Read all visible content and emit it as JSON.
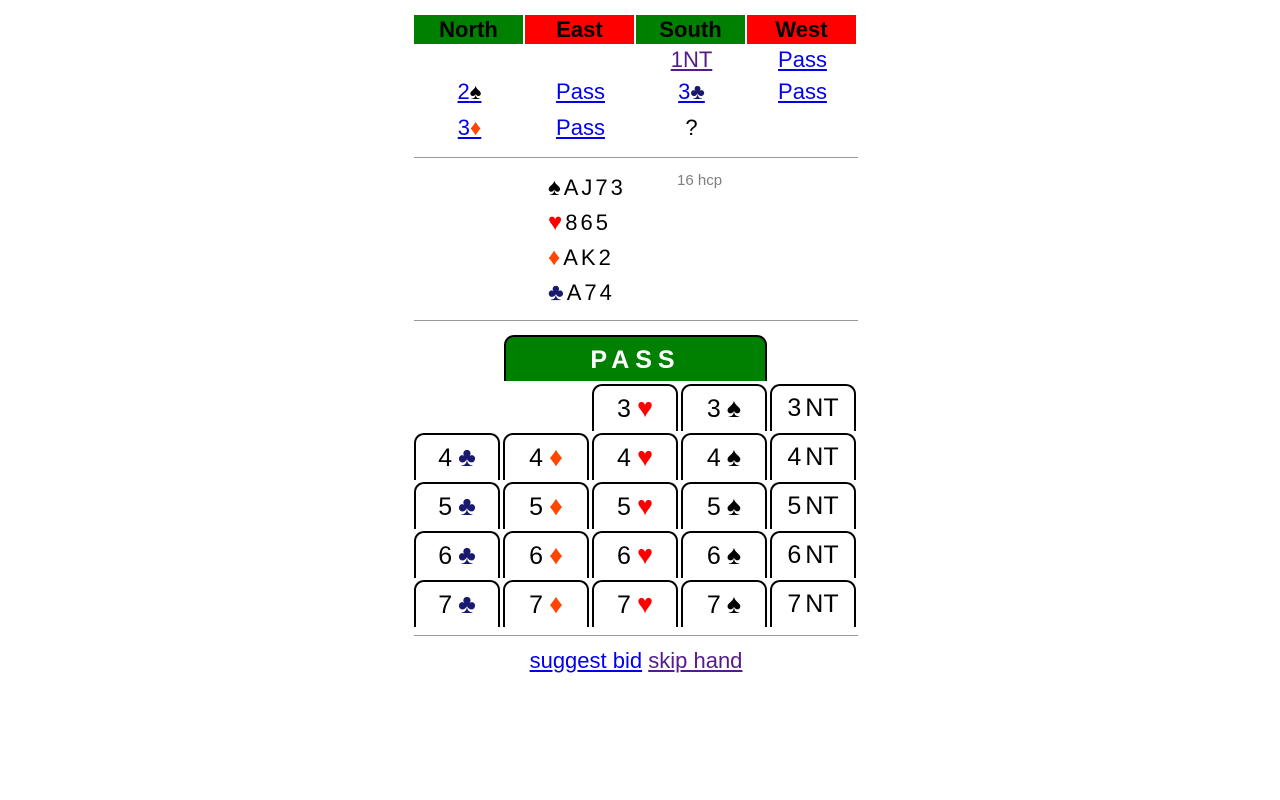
{
  "auction": {
    "headers": [
      {
        "label": "North",
        "color": "#008000"
      },
      {
        "label": "East",
        "color": "#ff0000"
      },
      {
        "label": "South",
        "color": "#008000"
      },
      {
        "label": "West",
        "color": "#ff0000"
      }
    ],
    "row1": {
      "south": "1NT",
      "west": "Pass"
    },
    "row2": {
      "north_level": "2",
      "north_suit": "♠",
      "east": "Pass",
      "south_level": "3",
      "south_suit": "♣",
      "west": "Pass"
    },
    "row3": {
      "north_level": "3",
      "north_suit": "♦",
      "east": "Pass",
      "south": "?"
    }
  },
  "hand": {
    "spades": {
      "symbol": "♠",
      "cards": "AJ73"
    },
    "hearts": {
      "symbol": "♥",
      "cards": "865"
    },
    "diamonds": {
      "symbol": "♦",
      "cards": "AK2"
    },
    "clubs": {
      "symbol": "♣",
      "cards": "A74"
    },
    "hcp": "16 hcp"
  },
  "bidbox": {
    "pass_label": "PASS",
    "bids": [
      {
        "level": "3",
        "suit": "♥",
        "kind": "heart"
      },
      {
        "level": "3",
        "suit": "♠",
        "kind": "spade"
      },
      {
        "level": "3",
        "suit": "NT",
        "kind": "nt"
      },
      {
        "level": "4",
        "suit": "♣",
        "kind": "club"
      },
      {
        "level": "4",
        "suit": "♦",
        "kind": "diamond"
      },
      {
        "level": "4",
        "suit": "♥",
        "kind": "heart"
      },
      {
        "level": "4",
        "suit": "♠",
        "kind": "spade"
      },
      {
        "level": "4",
        "suit": "NT",
        "kind": "nt"
      },
      {
        "level": "5",
        "suit": "♣",
        "kind": "club"
      },
      {
        "level": "5",
        "suit": "♦",
        "kind": "diamond"
      },
      {
        "level": "5",
        "suit": "♥",
        "kind": "heart"
      },
      {
        "level": "5",
        "suit": "♠",
        "kind": "spade"
      },
      {
        "level": "5",
        "suit": "NT",
        "kind": "nt"
      },
      {
        "level": "6",
        "suit": "♣",
        "kind": "club"
      },
      {
        "level": "6",
        "suit": "♦",
        "kind": "diamond"
      },
      {
        "level": "6",
        "suit": "♥",
        "kind": "heart"
      },
      {
        "level": "6",
        "suit": "♠",
        "kind": "spade"
      },
      {
        "level": "6",
        "suit": "NT",
        "kind": "nt"
      },
      {
        "level": "7",
        "suit": "♣",
        "kind": "club"
      },
      {
        "level": "7",
        "suit": "♦",
        "kind": "diamond"
      },
      {
        "level": "7",
        "suit": "♥",
        "kind": "heart"
      },
      {
        "level": "7",
        "suit": "♠",
        "kind": "spade"
      },
      {
        "level": "7",
        "suit": "NT",
        "kind": "nt"
      }
    ]
  },
  "footer": {
    "suggest_label": "suggest bid",
    "skip_label": "skip hand"
  },
  "colors": {
    "spade": "#000000",
    "heart": "#ff0000",
    "diamond": "#ff4500",
    "club": "#191970",
    "link": "#0000ee",
    "visited_link": "#551a8b",
    "pass_button": "#008000"
  }
}
